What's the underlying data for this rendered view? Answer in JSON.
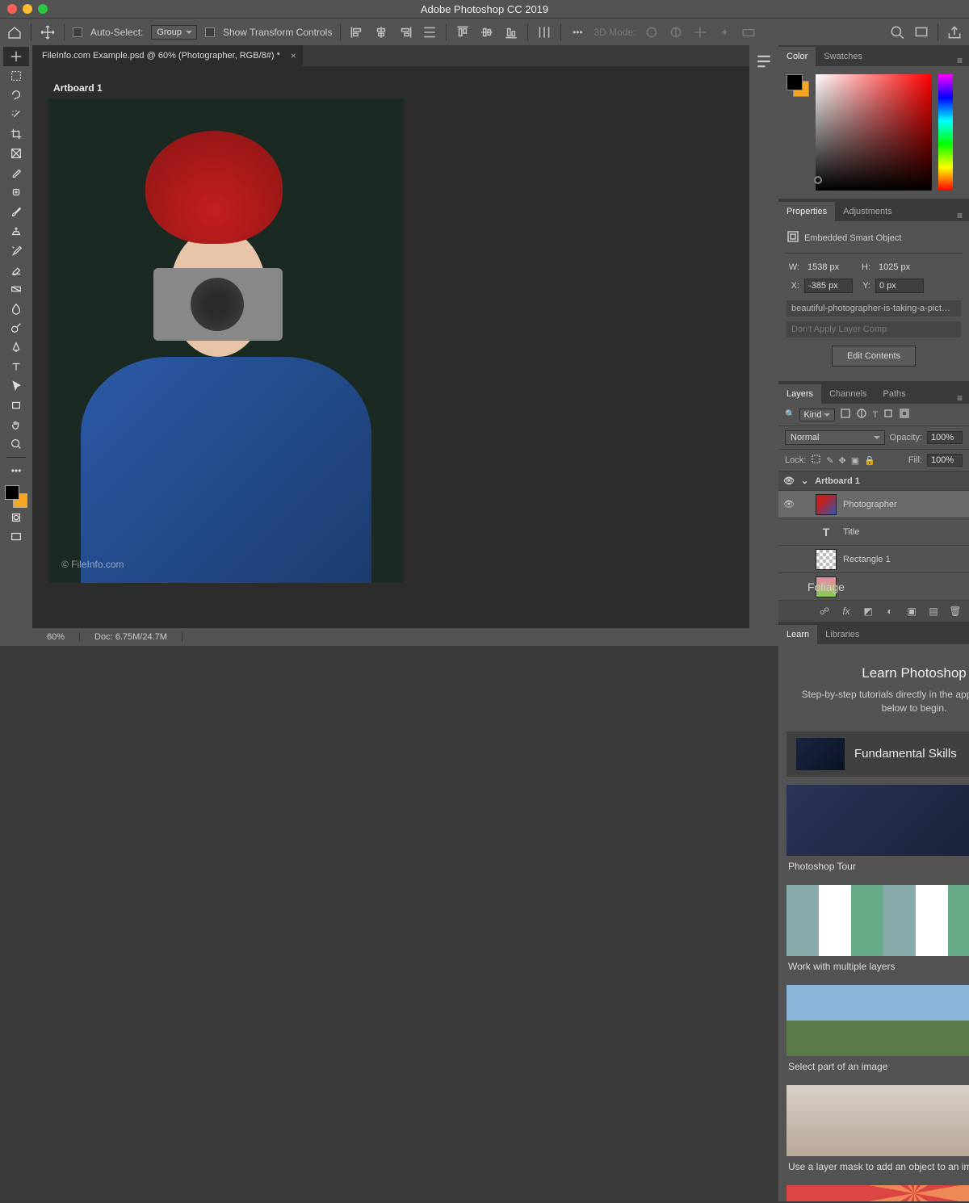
{
  "window": {
    "title": "Adobe Photoshop CC 2019"
  },
  "options_bar": {
    "auto_select": "Auto-Select:",
    "group": "Group",
    "show_transform": "Show Transform Controls",
    "mode3d": "3D Mode:"
  },
  "document": {
    "tab_title": "FileInfo.com Example.psd @ 60% (Photographer, RGB/8#) *",
    "artboard_label": "Artboard 1",
    "watermark": "© FileInfo.com"
  },
  "status_bar": {
    "zoom": "60%",
    "doc": "Doc: 6.75M/24.7M"
  },
  "panels": {
    "color": {
      "tab1": "Color",
      "tab2": "Swatches"
    },
    "properties": {
      "tab1": "Properties",
      "tab2": "Adjustments",
      "type_label": "Embedded Smart Object",
      "w_label": "W:",
      "w_val": "1538 px",
      "h_label": "H:",
      "h_val": "1025 px",
      "x_label": "X:",
      "x_val": "-385 px",
      "y_label": "Y:",
      "y_val": "0 px",
      "filename": "beautiful-photographer-is-taking-a-pict…",
      "layer_comp": "Don't Apply Layer Comp",
      "edit_btn": "Edit Contents"
    },
    "layers": {
      "tab1": "Layers",
      "tab2": "Channels",
      "tab3": "Paths",
      "kind": "Kind",
      "blend": "Normal",
      "opacity_label": "Opacity:",
      "opacity": "100%",
      "lock_label": "Lock:",
      "fill_label": "Fill:",
      "fill": "100%",
      "items": [
        {
          "name": "Artboard 1",
          "type": "artboard"
        },
        {
          "name": "Photographer",
          "type": "smart"
        },
        {
          "name": "Title",
          "type": "text"
        },
        {
          "name": "Rectangle 1",
          "type": "shape"
        },
        {
          "name": "Foliage",
          "type": "smart"
        }
      ]
    },
    "learn": {
      "tab1": "Learn",
      "tab2": "Libraries",
      "heading": "Learn Photoshop",
      "sub": "Step-by-step tutorials directly in the app. Pick a topic below to begin.",
      "fundamental": "Fundamental Skills",
      "tuts": [
        "Photoshop Tour",
        "Work with multiple layers",
        "Select part of an image",
        "Use a layer mask to add an object to an image"
      ]
    }
  }
}
